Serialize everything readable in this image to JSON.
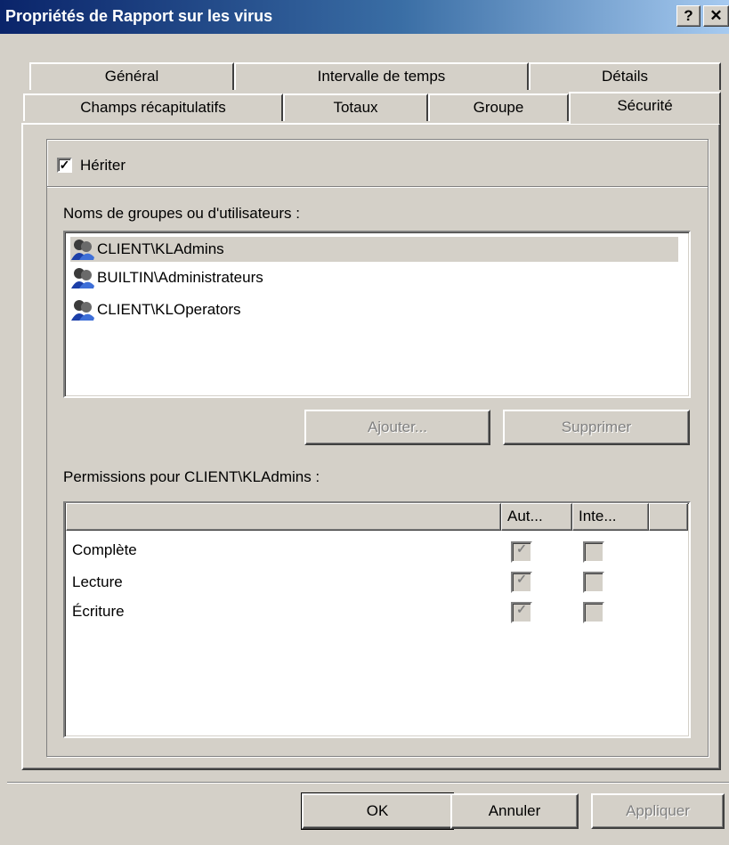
{
  "window": {
    "title": "Propriétés de Rapport sur les virus",
    "help_label": "?",
    "close_label": "✕"
  },
  "tabs": {
    "row1": [
      {
        "label": "Général"
      },
      {
        "label": "Intervalle de temps"
      },
      {
        "label": "Détails"
      }
    ],
    "row2": [
      {
        "label": "Champs récapitulatifs"
      },
      {
        "label": "Totaux"
      },
      {
        "label": "Groupe"
      },
      {
        "label": "Sécurité",
        "active": true
      }
    ]
  },
  "security": {
    "inherit_label": "Hériter",
    "inherit_checked": true,
    "users_label": "Noms de groupes ou d'utilisateurs :",
    "users": [
      {
        "name": "CLIENT\\KLAdmins",
        "selected": true
      },
      {
        "name": "BUILTIN\\Administrateurs"
      },
      {
        "name": "CLIENT\\KLOperators"
      }
    ],
    "add_button": "Ajouter...",
    "remove_button": "Supprimer",
    "permissions_label": "Permissions pour CLIENT\\KLAdmins :",
    "columns": {
      "name": "",
      "allow": "Aut...",
      "deny": "Inte..."
    },
    "permissions": [
      {
        "name": "Complète",
        "allow": true,
        "deny": false
      },
      {
        "name": "Lecture",
        "allow": true,
        "deny": false
      },
      {
        "name": "Écriture",
        "allow": true,
        "deny": false
      }
    ]
  },
  "footer": {
    "ok": "OK",
    "cancel": "Annuler",
    "apply": "Appliquer"
  },
  "colors": {
    "titlebar_start": "#0a246a",
    "titlebar_end": "#a6caf0",
    "face": "#d4d0c8"
  },
  "icons": {
    "user_group": "user-group-icon",
    "checkmark": "checkmark-icon"
  }
}
